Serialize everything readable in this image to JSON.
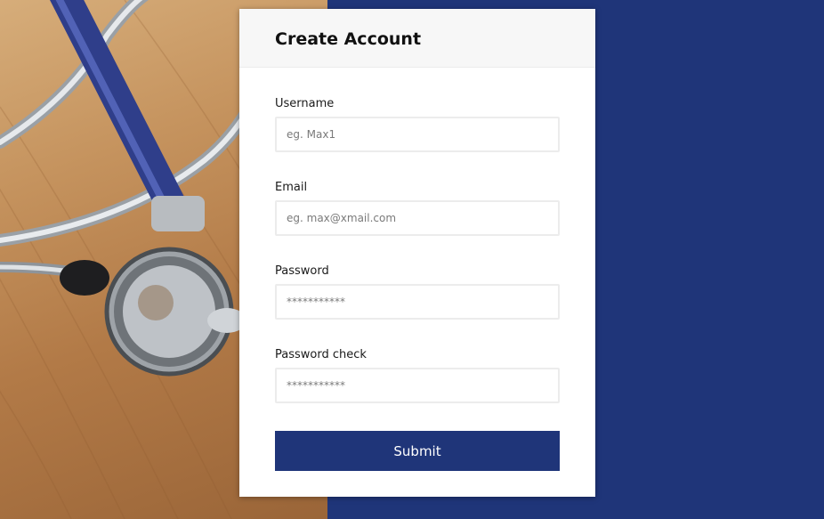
{
  "colors": {
    "accent": "#1f3579",
    "header_bg": "#f7f7f7",
    "card_bg": "#ffffff"
  },
  "background_image": {
    "subject": "stethoscope on wooden table"
  },
  "form": {
    "title": "Create Account",
    "fields": [
      {
        "label": "Username",
        "placeholder": "eg. Max1",
        "type": "text"
      },
      {
        "label": "Email",
        "placeholder": "eg. max@xmail.com",
        "type": "email"
      },
      {
        "label": "Password",
        "placeholder": "***********",
        "type": "password"
      },
      {
        "label": "Password check",
        "placeholder": "***********",
        "type": "password"
      }
    ],
    "submit_label": "Submit"
  }
}
